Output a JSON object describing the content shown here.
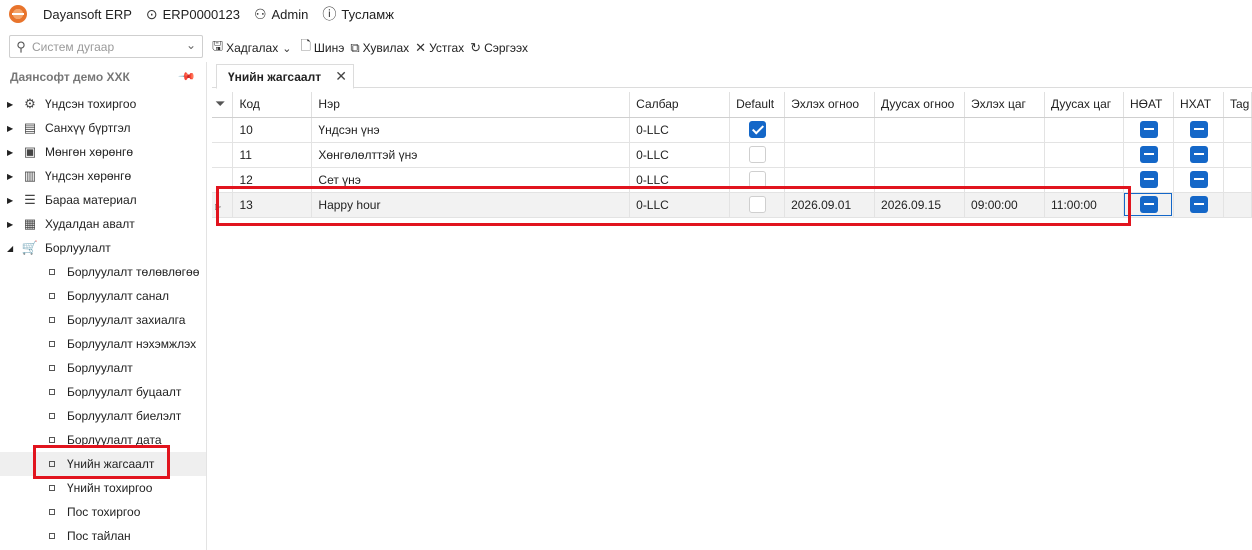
{
  "topbar": {
    "app_name": "Dayansoft ERP",
    "db_code": "ERP0000123",
    "user": "Admin",
    "help": "Тусламж"
  },
  "search": {
    "placeholder": "Систем дугаар"
  },
  "toolbar": {
    "save": "Хадгалах",
    "new": "Шинэ",
    "copy": "Хувилах",
    "delete": "Устгах",
    "refresh": "Сэргээх"
  },
  "sidebar": {
    "company": "Даянсофт демо ХХК",
    "modules": [
      {
        "label": "Үндсэн тохиргоо",
        "icon": "gear-icon"
      },
      {
        "label": "Санхүү бүртгэл",
        "icon": "ledger-icon"
      },
      {
        "label": "Мөнгөн хөрөнгө",
        "icon": "money-icon"
      },
      {
        "label": "Үндсэн хөрөнгө",
        "icon": "building-icon"
      },
      {
        "label": "Бараа материал",
        "icon": "warehouse-icon"
      },
      {
        "label": "Худалдан авалт",
        "icon": "purchase-icon"
      },
      {
        "label": "Борлуулалт",
        "icon": "cart-icon"
      }
    ],
    "sales_items": [
      "Борлуулалт төлөвлөгөө",
      "Борлуулалт санал",
      "Борлуулалт захиалга",
      "Борлуулалт нэхэмжлэх",
      "Борлуулалт",
      "Борлуулалт буцаалт",
      "Борлуулалт биелэлт",
      "Борлуулалт дата",
      "Үнийн жагсаалт",
      "Үнийн тохиргоо",
      "Пос тохиргоо",
      "Пос тайлан"
    ],
    "active_item": "Үнийн жагсаалт"
  },
  "tab": {
    "label": "Үнийн жагсаалт"
  },
  "grid": {
    "columns": [
      "Код",
      "Нэр",
      "Салбар",
      "Default",
      "Эхлэх огноо",
      "Дуусах огноо",
      "Эхлэх цаг",
      "Дуусах цаг",
      "НӨАТ",
      "НХАТ",
      "Tag"
    ],
    "rows": [
      {
        "code": "10",
        "name": "Үндсэн үнэ",
        "branch": "0-LLC",
        "default": true,
        "start_date": "",
        "end_date": "",
        "start_time": "",
        "end_time": ""
      },
      {
        "code": "11",
        "name": "Хөнгөлөлттэй үнэ",
        "branch": "0-LLC",
        "default": false,
        "start_date": "",
        "end_date": "",
        "start_time": "",
        "end_time": ""
      },
      {
        "code": "12",
        "name": "Сет үнэ",
        "branch": "0-LLC",
        "default": false,
        "start_date": "",
        "end_date": "",
        "start_time": "",
        "end_time": ""
      },
      {
        "code": "13",
        "name": "Happy hour",
        "branch": "0-LLC",
        "default": false,
        "start_date": "2026.09.01",
        "end_date": "2026.09.15",
        "start_time": "09:00:00",
        "end_time": "11:00:00"
      }
    ]
  },
  "colors": {
    "accent": "#1467c8",
    "highlight": "#e1141e"
  }
}
